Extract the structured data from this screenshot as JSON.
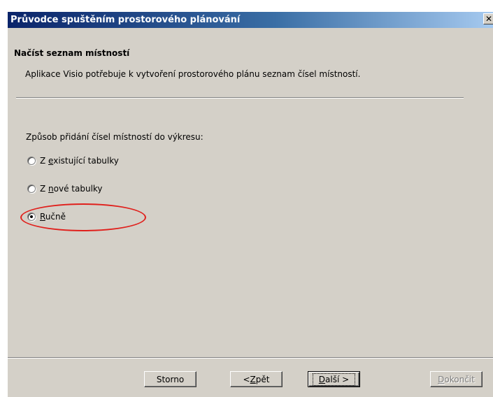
{
  "window": {
    "title": "Průvodce spuštěním prostorového plánování",
    "close_glyph": "✕"
  },
  "header": {
    "title": "Načíst seznam místností",
    "description": "Aplikace Visio potřebuje k vytvoření prostorového plánu seznam čísel místností."
  },
  "body": {
    "prompt": "Způsob přidání čísel místností do výkresu:",
    "options": [
      {
        "pre": "Z ",
        "accel": "e",
        "post": "xistující tabulky",
        "checked": false
      },
      {
        "pre": "Z ",
        "accel": "n",
        "post": "ové tabulky",
        "checked": false
      },
      {
        "pre": "",
        "accel": "R",
        "post": "učně",
        "checked": true
      }
    ]
  },
  "buttons": {
    "cancel": "Storno",
    "back_pre": "< ",
    "back_accel": "Z",
    "back_post": "pět",
    "next_accel": "D",
    "next_post": "alší >",
    "finish_accel": "D",
    "finish_post": "okončit"
  },
  "colors": {
    "dialog_bg": "#d4d0c8",
    "title_gradient_start": "#0a246a",
    "highlight": "#e0201c"
  }
}
